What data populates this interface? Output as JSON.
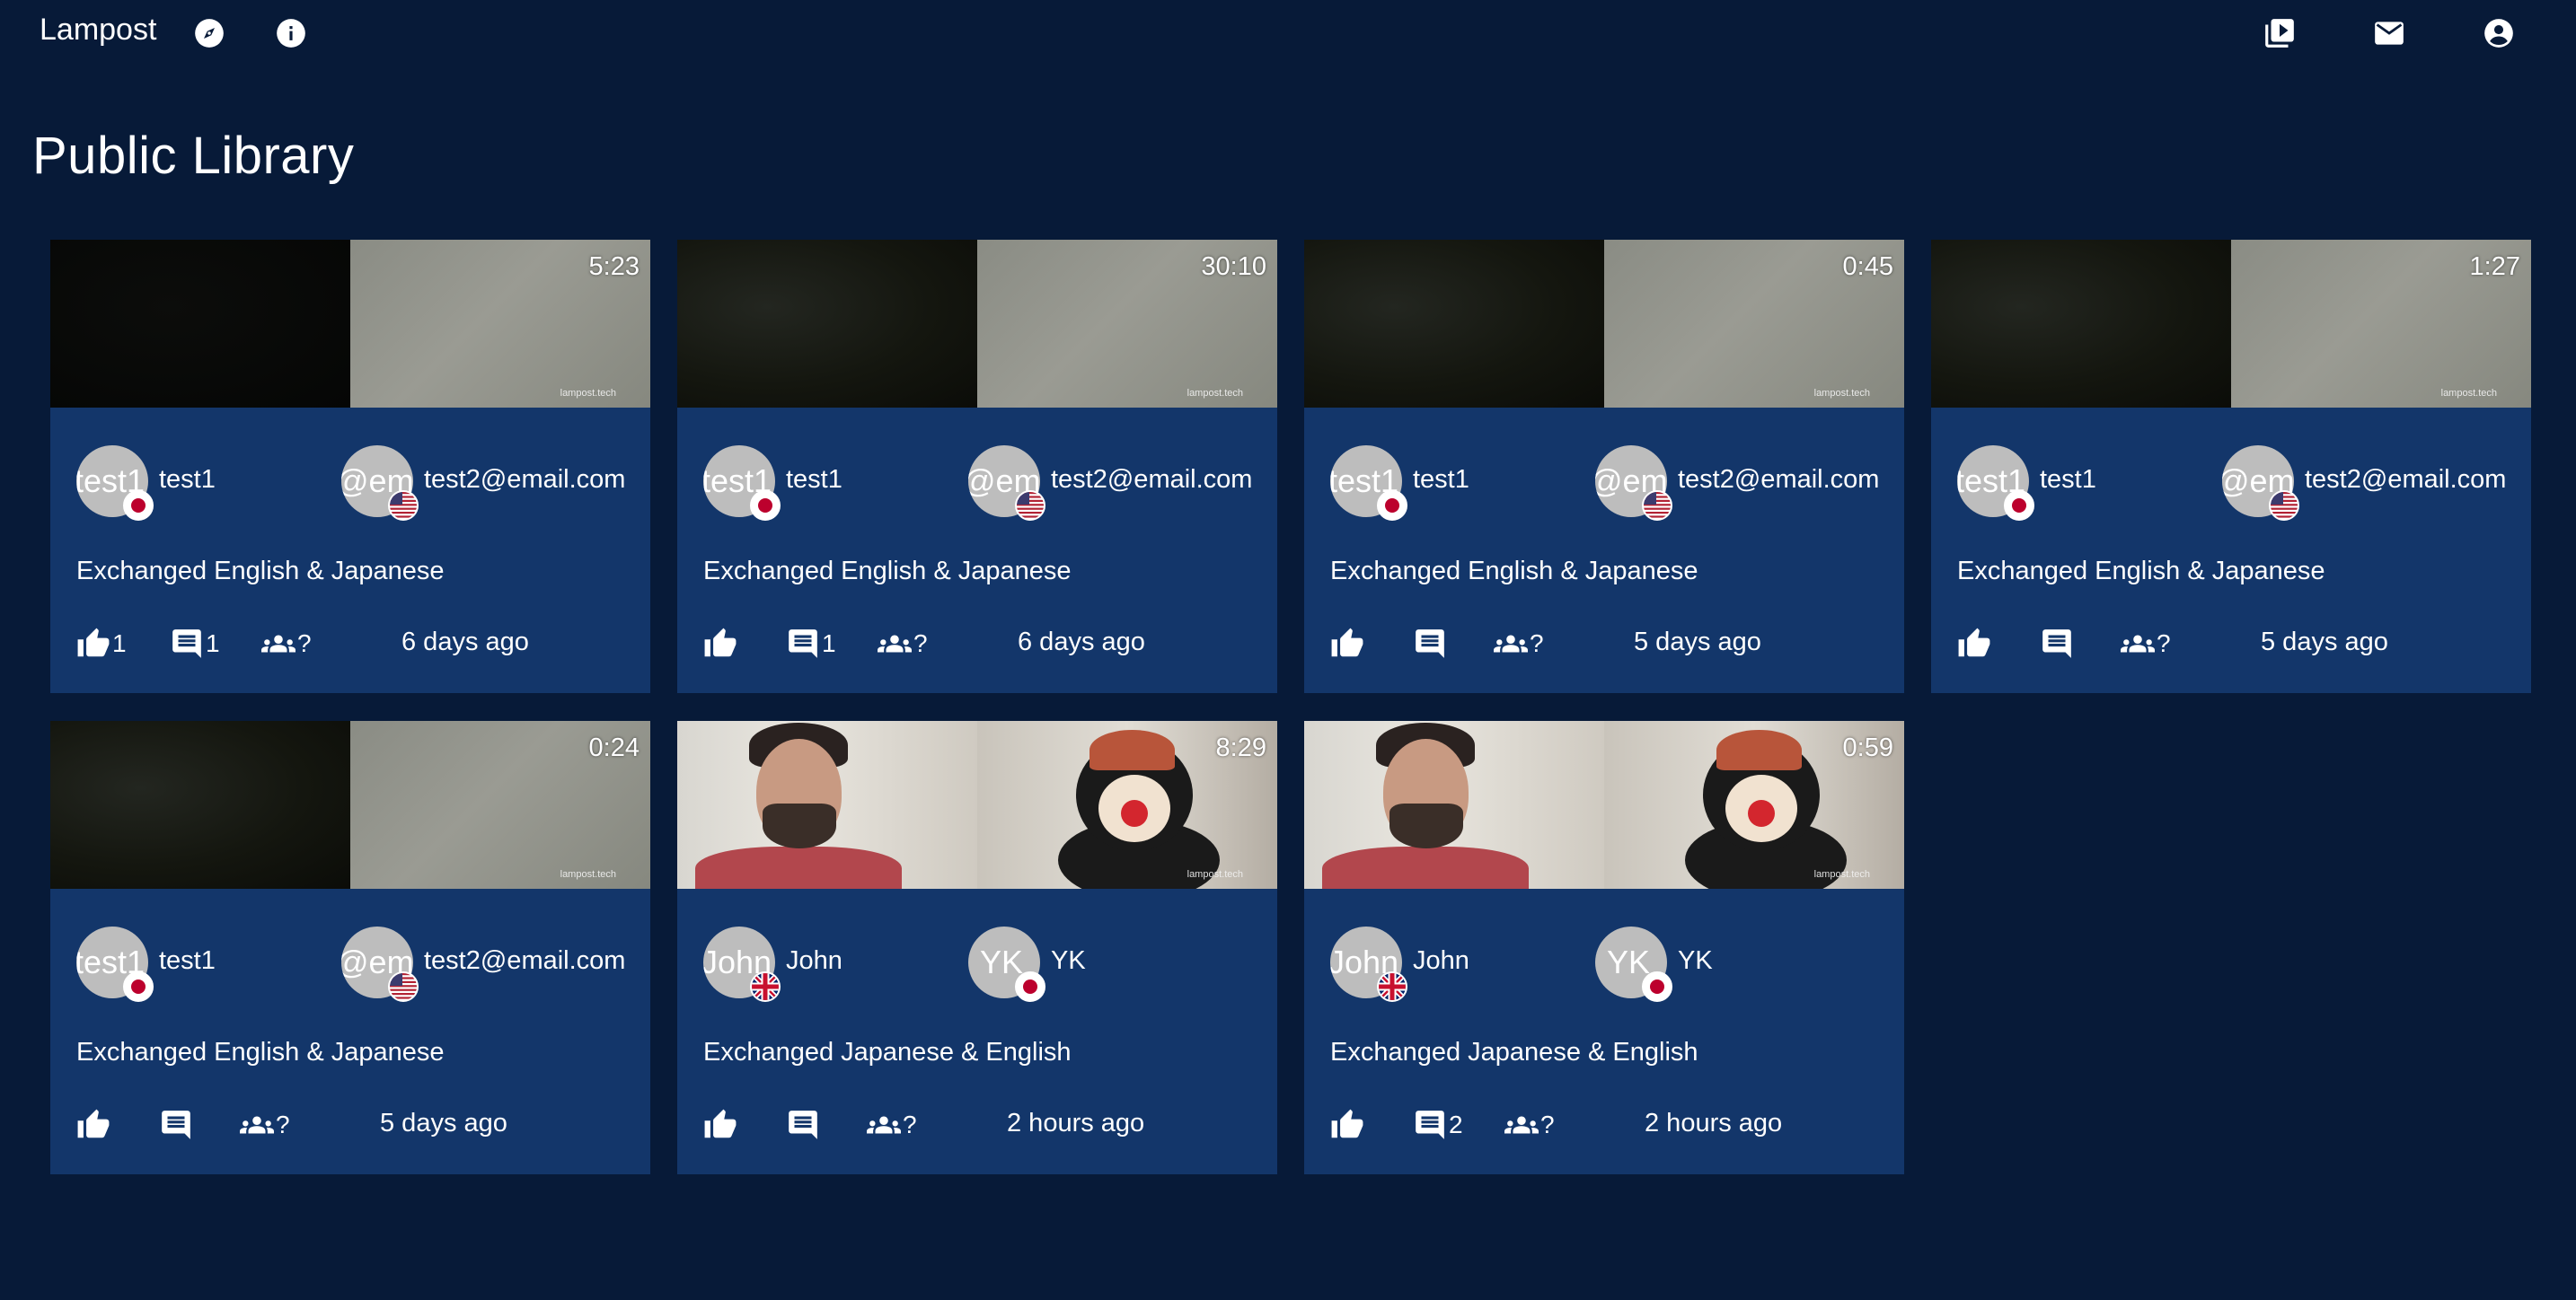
{
  "app": {
    "brand": "Lampost",
    "nav_icons": [
      "compass-icon",
      "info-icon"
    ],
    "right_icons": [
      "video-library-icon",
      "mail-icon",
      "account-icon"
    ]
  },
  "page": {
    "title": "Public Library"
  },
  "colors": {
    "background": "#071a38",
    "card": "#13366a",
    "avatar": "#bdbdbd"
  },
  "cards": [
    {
      "duration": "5:23",
      "watermark": "lampost.tech",
      "thumb": [
        "black",
        "grey"
      ],
      "people": [
        {
          "avatar_text": "test1",
          "name": "test1",
          "flag": "japan-flag-icon"
        },
        {
          "avatar_text": "@ema",
          "name": "test2@email.com",
          "flag": "us-flag-icon"
        }
      ],
      "caption": "Exchanged English & Japanese",
      "likes": "1",
      "comments": "1",
      "participants": "?",
      "ago": "6 days ago"
    },
    {
      "duration": "30:10",
      "watermark": "lampost.tech",
      "thumb": [
        "dark",
        "grey"
      ],
      "people": [
        {
          "avatar_text": "test1",
          "name": "test1",
          "flag": "japan-flag-icon"
        },
        {
          "avatar_text": "@ema",
          "name": "test2@email.com",
          "flag": "us-flag-icon"
        }
      ],
      "caption": "Exchanged English & Japanese",
      "likes": "",
      "comments": "1",
      "participants": "?",
      "ago": "6 days ago"
    },
    {
      "duration": "0:45",
      "watermark": "lampost.tech",
      "thumb": [
        "dark",
        "grey"
      ],
      "people": [
        {
          "avatar_text": "test1",
          "name": "test1",
          "flag": "japan-flag-icon"
        },
        {
          "avatar_text": "@ema",
          "name": "test2@email.com",
          "flag": "us-flag-icon"
        }
      ],
      "caption": "Exchanged English & Japanese",
      "likes": "",
      "comments": "",
      "participants": "?",
      "ago": "5 days ago"
    },
    {
      "duration": "1:27",
      "watermark": "lampost.tech",
      "thumb": [
        "dark",
        "grey"
      ],
      "people": [
        {
          "avatar_text": "test1",
          "name": "test1",
          "flag": "japan-flag-icon"
        },
        {
          "avatar_text": "@ema",
          "name": "test2@email.com",
          "flag": "us-flag-icon"
        }
      ],
      "caption": "Exchanged English & Japanese",
      "likes": "",
      "comments": "",
      "participants": "?",
      "ago": "5 days ago"
    },
    {
      "duration": "0:24",
      "watermark": "lampost.tech",
      "thumb": [
        "dark",
        "grey"
      ],
      "people": [
        {
          "avatar_text": "test1",
          "name": "test1",
          "flag": "japan-flag-icon"
        },
        {
          "avatar_text": "@ema",
          "name": "test2@email.com",
          "flag": "us-flag-icon"
        }
      ],
      "caption": "Exchanged English & Japanese",
      "likes": "",
      "comments": "",
      "participants": "?",
      "ago": "5 days ago"
    },
    {
      "duration": "8:29",
      "watermark": "lampost.tech",
      "thumb": [
        "person",
        "plush"
      ],
      "people": [
        {
          "avatar_text": "John",
          "name": "John",
          "flag": "uk-flag-icon"
        },
        {
          "avatar_text": "YK",
          "name": "YK",
          "flag": "japan-flag-icon"
        }
      ],
      "caption": "Exchanged Japanese & English",
      "likes": "",
      "comments": "",
      "participants": "?",
      "ago": "2 hours ago"
    },
    {
      "duration": "0:59",
      "watermark": "lampost.tech",
      "thumb": [
        "person",
        "plush"
      ],
      "people": [
        {
          "avatar_text": "John",
          "name": "John",
          "flag": "uk-flag-icon"
        },
        {
          "avatar_text": "YK",
          "name": "YK",
          "flag": "japan-flag-icon"
        }
      ],
      "caption": "Exchanged Japanese & English",
      "likes": "",
      "comments": "2",
      "participants": "?",
      "ago": "2 hours ago"
    }
  ]
}
